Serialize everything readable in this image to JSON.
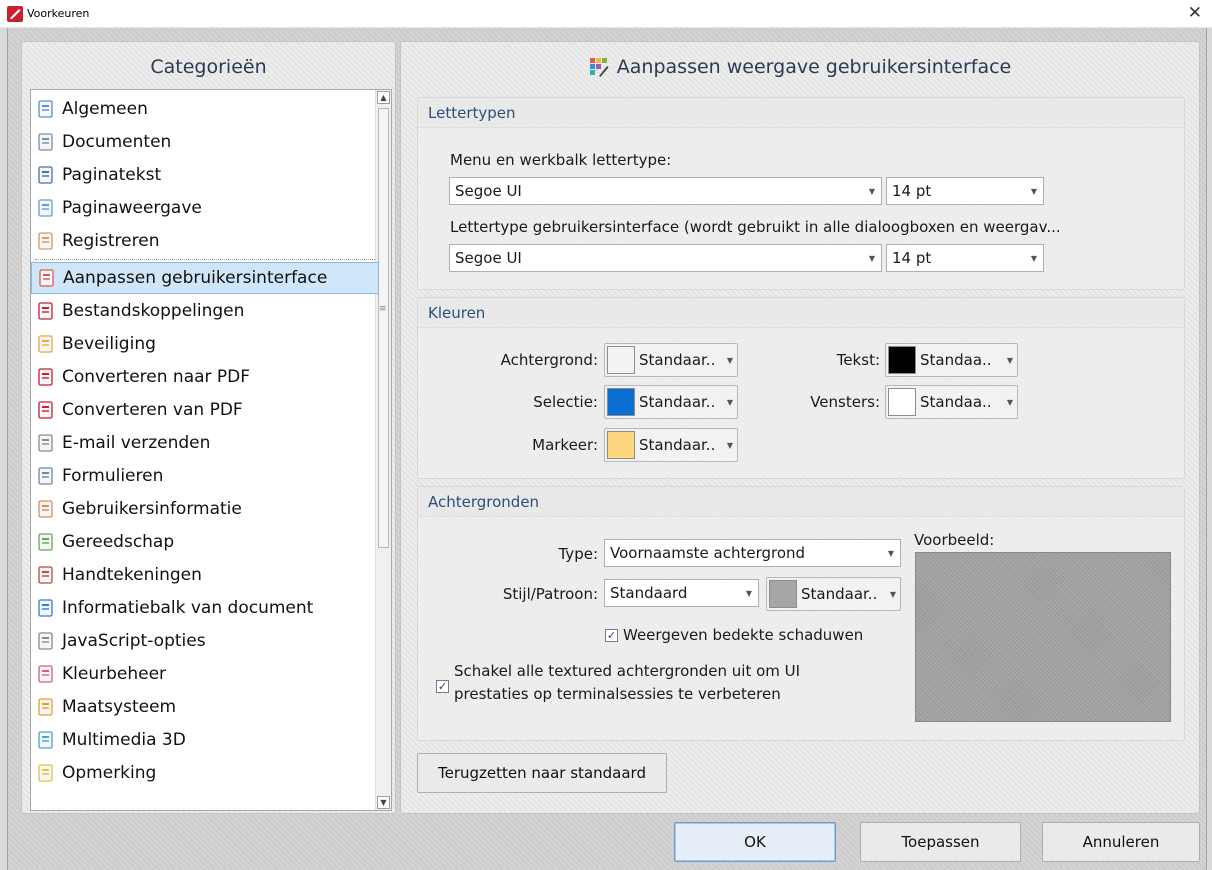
{
  "window": {
    "title": "Voorkeuren",
    "close_glyph": "✕"
  },
  "categories": {
    "header": "Categorieën",
    "items": [
      {
        "label": "Algemeen",
        "icon": "settings-page-icon"
      },
      {
        "label": "Documenten",
        "icon": "documents-icon"
      },
      {
        "label": "Paginatekst",
        "icon": "page-text-icon"
      },
      {
        "label": "Paginaweergave",
        "icon": "page-view-icon"
      },
      {
        "label": "Registreren",
        "icon": "user-add-icon"
      },
      {
        "label": "Aanpassen gebruikersinterface",
        "icon": "palette-icon",
        "selected": true
      },
      {
        "label": "Bestandskoppelingen",
        "icon": "pdf-file-icon"
      },
      {
        "label": "Beveiliging",
        "icon": "shield-icon"
      },
      {
        "label": "Converteren naar PDF",
        "icon": "convert-to-pdf-icon"
      },
      {
        "label": "Converteren van PDF",
        "icon": "convert-from-pdf-icon"
      },
      {
        "label": "E-mail verzenden",
        "icon": "email-icon"
      },
      {
        "label": "Formulieren",
        "icon": "form-icon"
      },
      {
        "label": "Gebruikersinformatie",
        "icon": "user-icon"
      },
      {
        "label": "Gereedschap",
        "icon": "tools-icon"
      },
      {
        "label": "Handtekeningen",
        "icon": "signature-icon"
      },
      {
        "label": "Informatiebalk van document",
        "icon": "info-icon"
      },
      {
        "label": "JavaScript-opties",
        "icon": "script-icon"
      },
      {
        "label": "Kleurbeheer",
        "icon": "color-wheel-icon"
      },
      {
        "label": "Maatsysteem",
        "icon": "ruler-icon"
      },
      {
        "label": "Multimedia 3D",
        "icon": "3d-shapes-icon"
      },
      {
        "label": "Opmerking",
        "icon": "comment-icon"
      }
    ]
  },
  "main": {
    "header": "Aanpassen weergave gebruikersinterface",
    "fonts": {
      "title": "Lettertypen",
      "menu_label": "Menu en werkbalk lettertype:",
      "menu_font": "Segoe UI",
      "menu_size": "14 pt",
      "ui_label": "Lettertype gebruikersinterface (wordt gebruikt in alle dialoogboxen en weergav...",
      "ui_font": "Segoe UI",
      "ui_size": "14 pt"
    },
    "colors": {
      "title": "Kleuren",
      "background_label": "Achtergrond:",
      "background_value": "Standaar..",
      "background_color": "#f2f2f2",
      "selection_label": "Selectie:",
      "selection_value": "Standaar..",
      "selection_color": "#0a6fd1",
      "highlight_label": "Markeer:",
      "highlight_value": "Standaar..",
      "highlight_color": "#fcd77f",
      "text_label": "Tekst:",
      "text_value": "Standaa..",
      "text_color": "#000000",
      "windows_label": "Vensters:",
      "windows_value": "Standaa..",
      "windows_color": "#ffffff"
    },
    "backgrounds": {
      "title": "Achtergronden",
      "type_label": "Type:",
      "type_value": "Voornaamste achtergrond",
      "style_label": "Stijl/Patroon:",
      "style_value": "Standaard",
      "pattern_color_value": "Standaar..",
      "pattern_color": "#a6a6a6",
      "show_shadows_label": "Weergeven bedekte schaduwen",
      "show_shadows_checked": true,
      "disable_textures_label_line1": "Schakel alle textured achtergronden uit om UI",
      "disable_textures_label_line2": "prestaties op terminalsessies te verbeteren",
      "disable_textures_checked": true,
      "preview_label": "Voorbeeld:"
    },
    "reset_button": "Terugzetten naar standaard"
  },
  "footer": {
    "ok": "OK",
    "apply": "Toepassen",
    "cancel": "Annuleren"
  }
}
